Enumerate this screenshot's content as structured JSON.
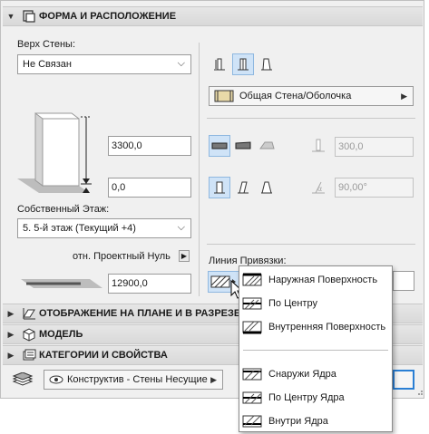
{
  "section_shape": {
    "title": "ФОРМА И РАСПОЛОЖЕНИЕ",
    "icon": "wall-frame-icon"
  },
  "top_of_wall": {
    "label": "Верх Стены:",
    "value": "Не Связан"
  },
  "height_value": "3300,0",
  "offset_value": "0,0",
  "home_story": {
    "label": "Собственный Этаж:",
    "value": "5. 5-й этаж (Текущий +4)"
  },
  "project_zero": {
    "label": "отн. Проектный Нуль",
    "value": "12900,0"
  },
  "structure": {
    "value": "Общая Стена/Оболочка",
    "icon": "composite-hatch-icon"
  },
  "thickness_value": "300,0",
  "angle_value": "90,00°",
  "reference_line": {
    "label": "Линия Привязки:"
  },
  "collapsed_sections": [
    {
      "title": "ОТОБРАЖЕНИЕ НА ПЛАНЕ И В РАЗРЕЗЕ",
      "icon": "floorplan-icon"
    },
    {
      "title": "МОДЕЛЬ",
      "icon": "model-box-icon"
    },
    {
      "title": "КАТЕГОРИИ И СВОЙСТВА",
      "icon": "categories-icon"
    }
  ],
  "layer": {
    "value": "Конструктив - Стены Несущие",
    "icon": "eye-icon"
  },
  "reference_menu": {
    "group1": [
      "Наружная Поверхность",
      "По Центру",
      "Внутренняя Поверхность"
    ],
    "group2": [
      "Снаружи Ядра",
      "По Центру Ядра",
      "Внутри Ядра"
    ]
  },
  "colors": {
    "selected_bg": "#cfe3f7",
    "selected_border": "#8fb8e0",
    "header_bg": "#dcdcdc",
    "panel_bg": "#f0f0f0"
  }
}
